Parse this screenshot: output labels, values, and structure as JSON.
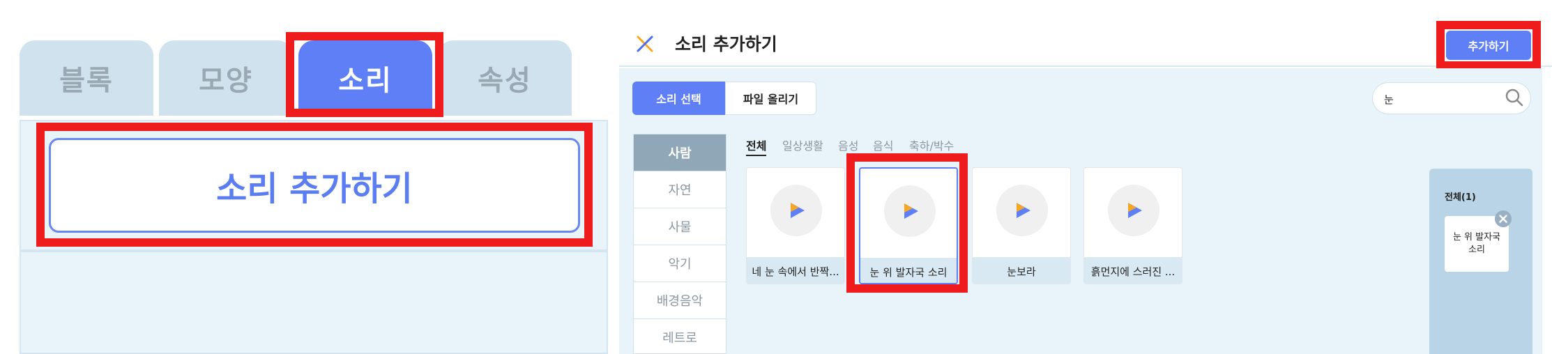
{
  "tabs": [
    {
      "label": "블록"
    },
    {
      "label": "모양"
    },
    {
      "label": "소리"
    },
    {
      "label": "속성"
    }
  ],
  "left_panel": {
    "add_sound_label": "소리 추가하기"
  },
  "dialog": {
    "title": "소리 추가하기",
    "add_button": "추가하기",
    "segments": [
      "소리 선택",
      "파일 올리기"
    ],
    "search": {
      "value": "눈",
      "placeholder": ""
    },
    "categories": [
      "사람",
      "자연",
      "사물",
      "악기",
      "배경음악",
      "레트로"
    ],
    "subtabs": [
      "전체",
      "일상생활",
      "음성",
      "음식",
      "축하/박수"
    ],
    "sounds": [
      {
        "label": "네 눈 속에서 반짝..."
      },
      {
        "label": "눈 위 발자국 소리"
      },
      {
        "label": "눈보라"
      },
      {
        "label": "흙먼지에 스러진 ..."
      }
    ],
    "selected_panel": {
      "title": "전체(1)",
      "item_label": "눈 위 발자국 소리"
    }
  },
  "colors": {
    "accent": "#5f7ff7",
    "highlight": "#ee1c1c",
    "panel_bg": "#e8f4fa",
    "tab_inactive": "#cfe2ee"
  },
  "icons": {
    "close": "close-x-icon",
    "search": "search-icon",
    "play": "play-icon",
    "remove": "remove-icon"
  }
}
